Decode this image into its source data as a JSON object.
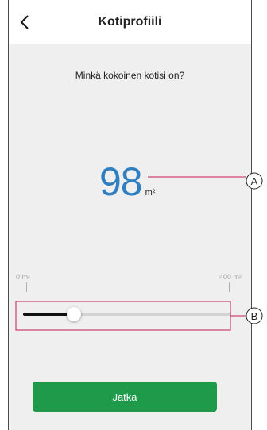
{
  "header": {
    "title": "Kotiprofiili",
    "back_icon": "chevron-left-icon"
  },
  "question": "Minkä kokoinen kotisi on?",
  "size": {
    "value": "98",
    "unit": "m²"
  },
  "slider": {
    "min_label": "0 m²",
    "max_label": "400 m²",
    "min": 0,
    "max": 400,
    "value": 98
  },
  "continue_label": "Jatka",
  "callouts": {
    "a": "A",
    "b": "B"
  },
  "colors": {
    "accent_blue": "#2f7fc1",
    "callout_red": "#c8185a",
    "button_green": "#1f9a4b"
  }
}
